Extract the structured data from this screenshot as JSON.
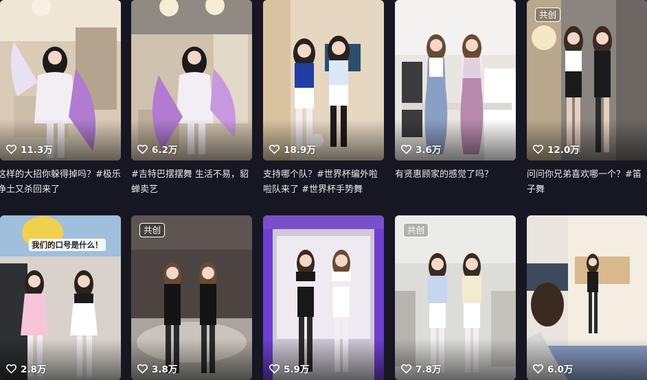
{
  "feed": {
    "items": [
      {
        "likes": "11.3万",
        "caption": "这样的大招你躲得掉吗？#极乐净土又杀回来了",
        "badge": ""
      },
      {
        "likes": "6.2万",
        "caption": "#吉特巴摆摆舞 生活不易，貂蝉卖艺",
        "badge": ""
      },
      {
        "likes": "18.9万",
        "caption": "支持哪个队？#世界杯编外啦啦队来了 #世界杯手势舞",
        "badge": ""
      },
      {
        "likes": "3.6万",
        "caption": "有贤惠顾家的感觉了吗？",
        "badge": ""
      },
      {
        "likes": "12.0万",
        "caption": "问问你兄弟喜欢哪一个？#笛子舞",
        "badge": "共创"
      },
      {
        "likes": "2.8万",
        "caption": "",
        "badge": "",
        "overlay_text": "我们的口号是什么！"
      },
      {
        "likes": "3.8万",
        "caption": "",
        "badge": "共创"
      },
      {
        "likes": "5.9万",
        "caption": "",
        "badge": ""
      },
      {
        "likes": "7.8万",
        "caption": "",
        "badge": "共创"
      },
      {
        "likes": "6.0万",
        "caption": "",
        "badge": ""
      }
    ]
  },
  "colors": {
    "background": "#161722",
    "text": "#e8e8ec",
    "badge_border": "#ffffff"
  },
  "icons": {
    "likes": "heart-outline-icon"
  }
}
